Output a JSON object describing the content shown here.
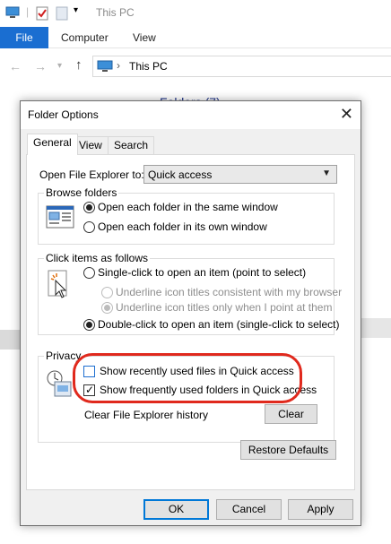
{
  "explorer": {
    "title": "This PC",
    "ribbon_tabs": [
      "File",
      "Computer",
      "View"
    ],
    "address": "This PC",
    "folders_heading": "Folders (7)"
  },
  "dialog": {
    "title": "Folder Options",
    "tabs": [
      "General",
      "View",
      "Search"
    ],
    "open_with_label": "Open File Explorer to:",
    "open_with_value": "Quick access",
    "browse": {
      "title": "Browse folders",
      "options": [
        "Open each folder in the same window",
        "Open each folder in its own window"
      ],
      "selected_index": 0
    },
    "click": {
      "title": "Click items as follows",
      "single": "Single-click to open an item (point to select)",
      "underline_always": "Underline icon titles consistent with my browser",
      "underline_point": "Underline icon titles only when I point at them",
      "double": "Double-click to open an item (single-click to select)"
    },
    "privacy": {
      "title": "Privacy",
      "recent_files": "Show recently used files in Quick access",
      "recent_files_checked": false,
      "frequent_folders": "Show frequently used folders in Quick access",
      "frequent_folders_checked": true,
      "clear_label": "Clear File Explorer history",
      "clear_button": "Clear"
    },
    "restore_button": "Restore Defaults",
    "ok_button": "OK",
    "cancel_button": "Cancel",
    "apply_button": "Apply"
  },
  "colors": {
    "accent": "#0078d7",
    "file_tab": "#1a6ed1",
    "highlight_circle": "#e0291d"
  }
}
